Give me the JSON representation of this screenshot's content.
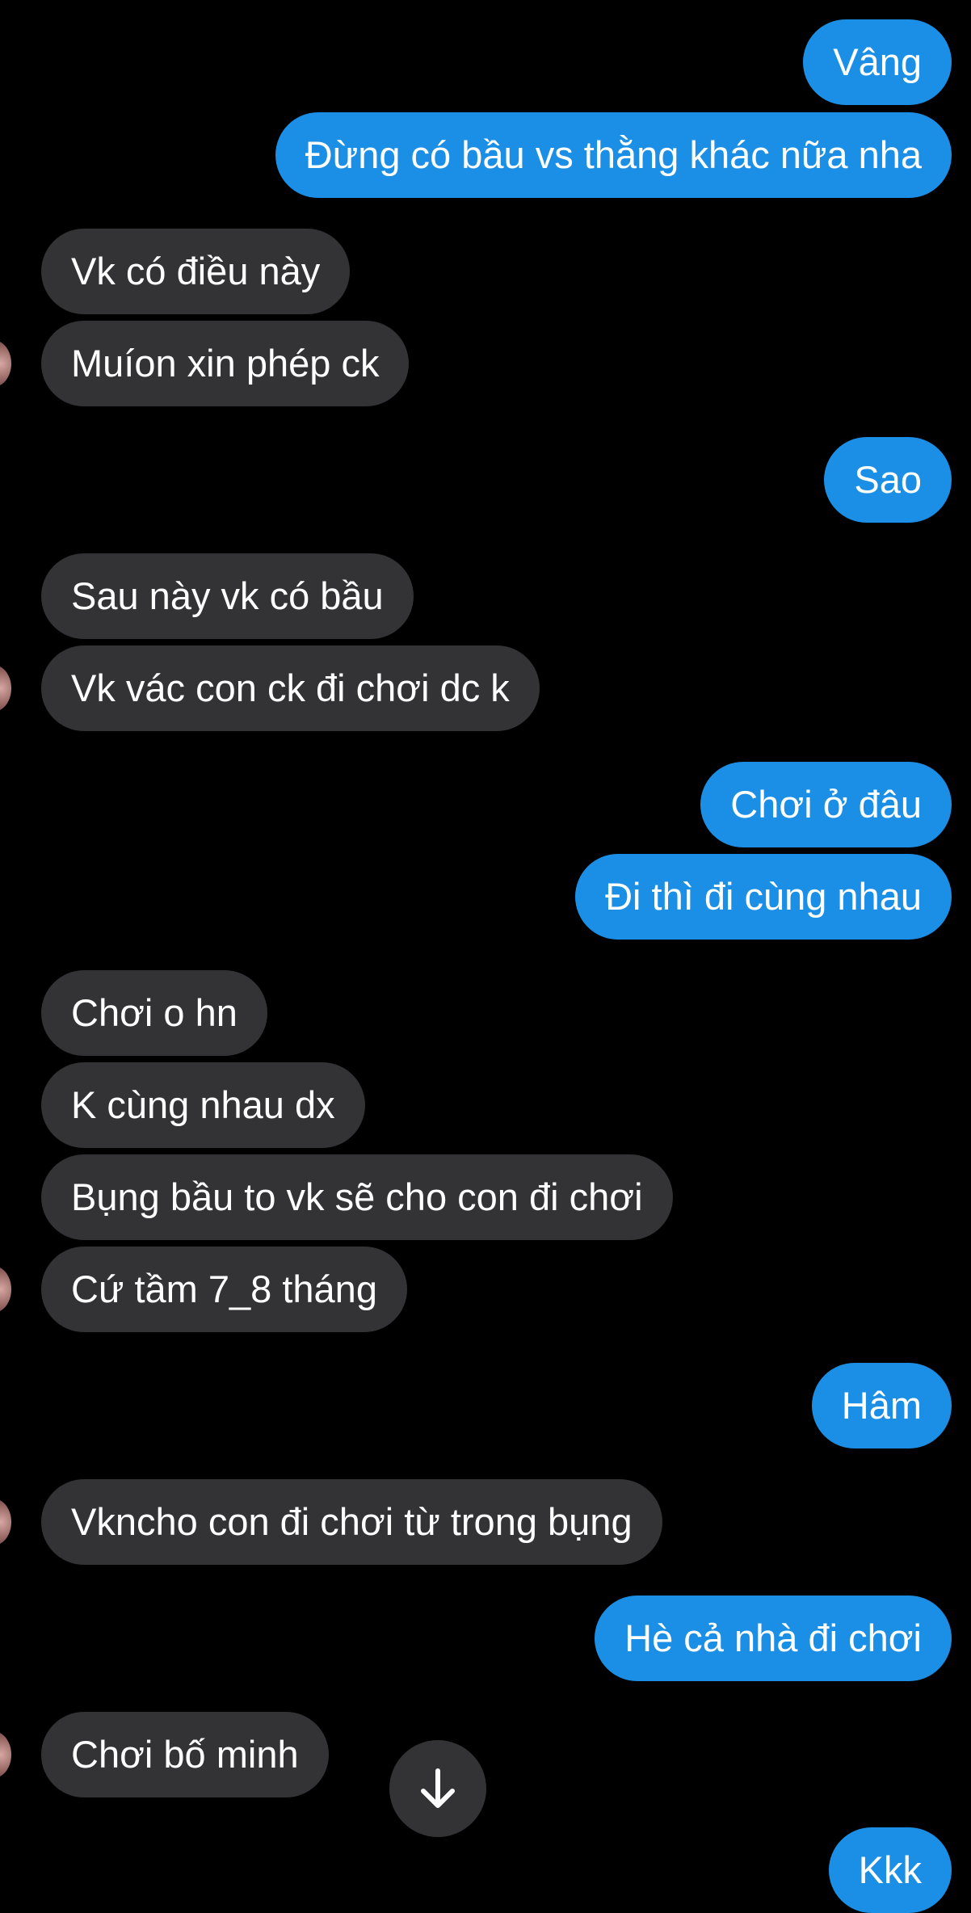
{
  "conversation": {
    "messages": [
      {
        "text": "Vâng",
        "direction": "out"
      },
      {
        "text": "Đừng có bầu vs thằng khác nữa nha",
        "direction": "out"
      },
      {
        "text": "Vk có điều này",
        "direction": "in"
      },
      {
        "text": "Muíon xin phép ck",
        "direction": "in"
      },
      {
        "text": "Sao",
        "direction": "out"
      },
      {
        "text": "Sau này vk có bầu",
        "direction": "in"
      },
      {
        "text": "Vk vác con ck đi chơi dc k",
        "direction": "in"
      },
      {
        "text": "Chơi ở đâu",
        "direction": "out"
      },
      {
        "text": "Đi thì đi cùng nhau",
        "direction": "out"
      },
      {
        "text": "Chơi o hn",
        "direction": "in"
      },
      {
        "text": "K cùng nhau dx",
        "direction": "in"
      },
      {
        "text": "Bụng bầu to vk sẽ cho con đi chơi",
        "direction": "in"
      },
      {
        "text": "Cứ tầm 7_8 tháng",
        "direction": "in"
      },
      {
        "text": "Hâm",
        "direction": "out"
      },
      {
        "text": "Vkncho con đi chơi từ trong bụng",
        "direction": "in"
      },
      {
        "text": "Hè cả nhà đi chơi",
        "direction": "out"
      },
      {
        "text": "Chơi bố minh",
        "direction": "in"
      },
      {
        "text": "Kkk",
        "direction": "out"
      }
    ]
  },
  "colors": {
    "background": "#000000",
    "outgoing_bubble": "#1b8fe6",
    "incoming_bubble": "#333336",
    "text": "#ffffff"
  },
  "icons": {
    "scroll_down": "arrow-down-icon",
    "avatar": "contact-avatar"
  }
}
